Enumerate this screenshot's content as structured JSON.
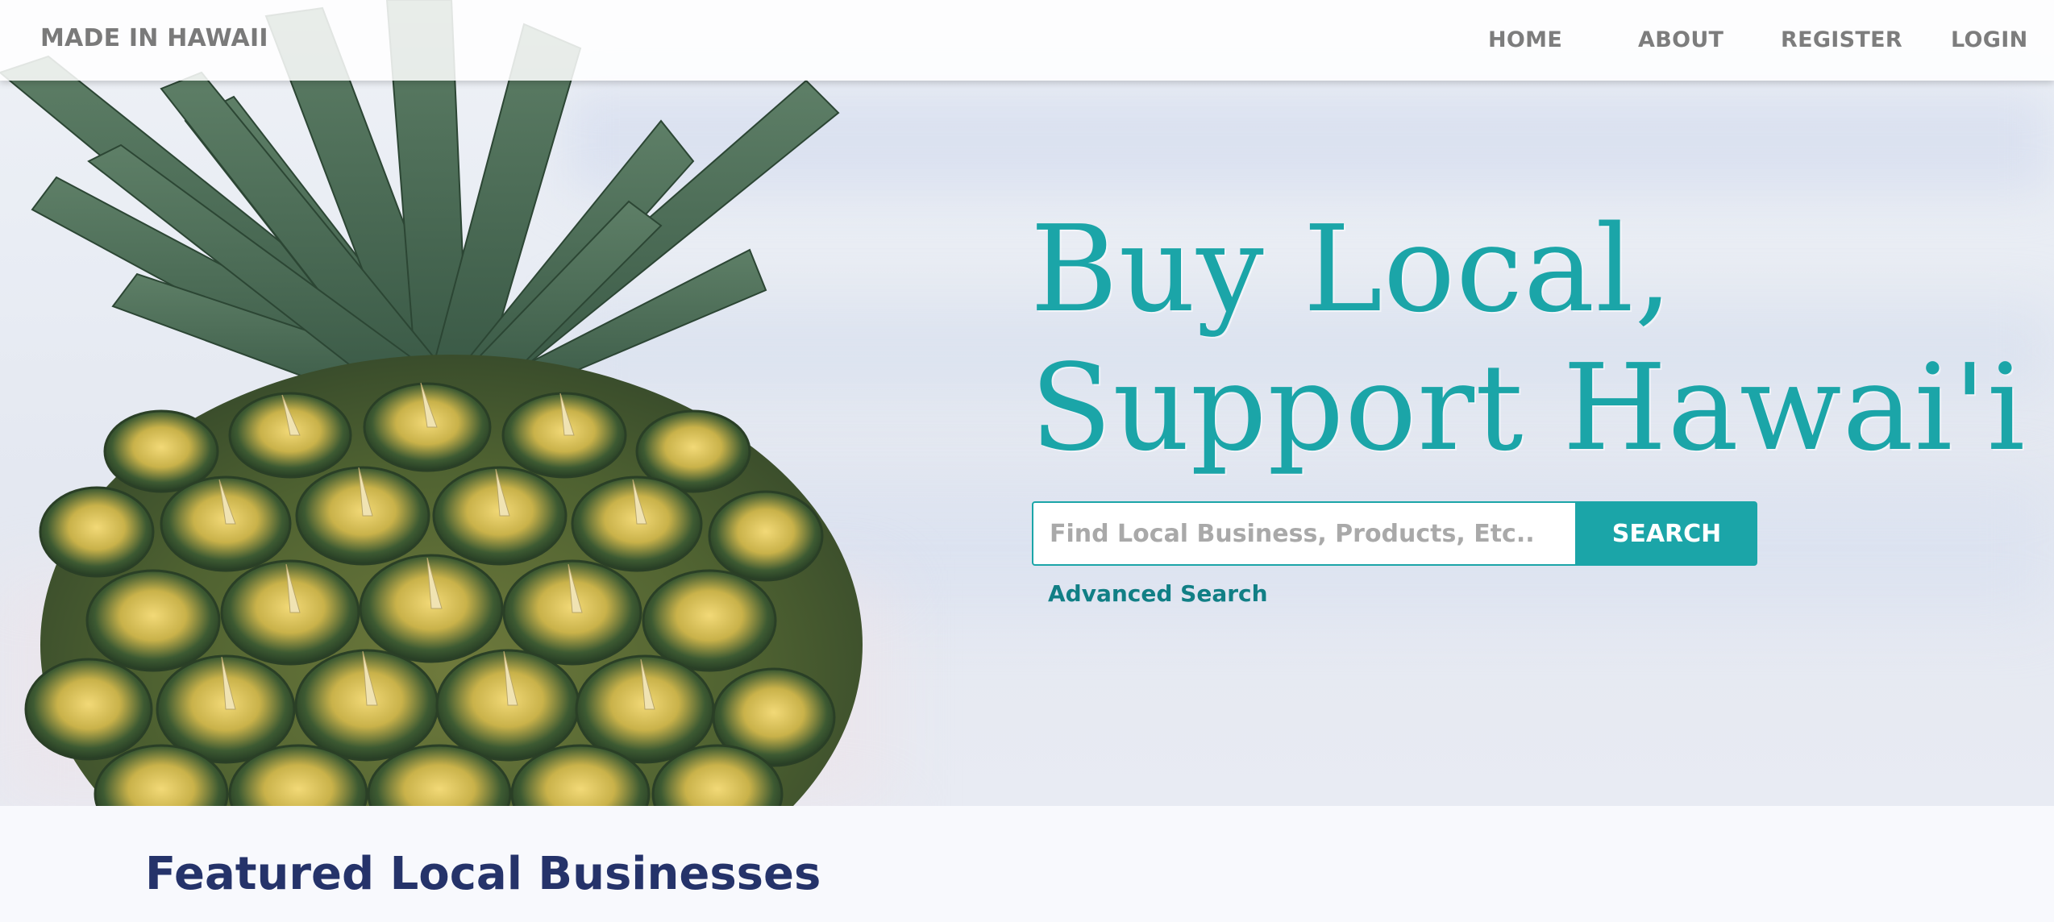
{
  "nav": {
    "brand": "MADE IN HAWAII",
    "items": [
      {
        "label": "HOME"
      },
      {
        "label": "ABOUT"
      },
      {
        "label": "REGISTER"
      },
      {
        "label": "LOGIN"
      }
    ]
  },
  "hero": {
    "headline_line1": "Buy Local,",
    "headline_line2": "Support Hawai'i",
    "search": {
      "placeholder": "Find Local Business, Products, Etc..",
      "value": "",
      "button_label": "SEARCH"
    },
    "advanced_search_label": "Advanced Search"
  },
  "featured": {
    "title": "Featured Local Businesses"
  },
  "colors": {
    "accent": "#1ba5a8",
    "nav_text": "#7d7d7d",
    "heading_navy": "#25336a",
    "link_teal": "#117f85"
  }
}
